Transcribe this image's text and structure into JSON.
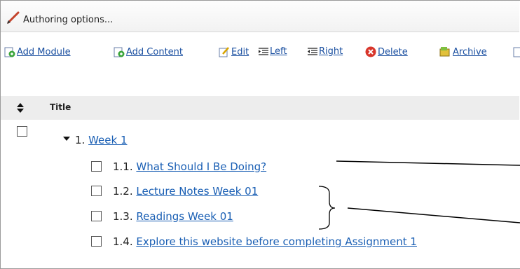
{
  "header": {
    "title": "Authoring options..."
  },
  "toolbar": [
    {
      "label": "Add Module",
      "icon": "add-module-icon"
    },
    {
      "label": "Add Content",
      "icon": "add-content-icon"
    },
    {
      "label": "Edit",
      "icon": "edit-icon"
    },
    {
      "label": "Left",
      "icon": "indent-left-icon"
    },
    {
      "label": "Right",
      "icon": "indent-right-icon"
    },
    {
      "label": "Delete",
      "icon": "delete-icon"
    },
    {
      "label": "Archive",
      "icon": "archive-icon"
    }
  ],
  "table": {
    "column_title": "Title"
  },
  "module": {
    "number": "1.",
    "title": "Week 1"
  },
  "items": [
    {
      "number": "1.1.",
      "title": "What Should I Be Doing?"
    },
    {
      "number": "1.2.",
      "title": "Lecture Notes Week 01"
    },
    {
      "number": "1.3.",
      "title": "Readings Week 01"
    },
    {
      "number": "1.4.",
      "title": "Explore this website before completing Assignment 1"
    }
  ],
  "colors": {
    "link": "#1a5fb4",
    "toolbar_link": "#1a4fa0",
    "header_bg": "#f5f5f5",
    "column_bar": "#ededed"
  }
}
